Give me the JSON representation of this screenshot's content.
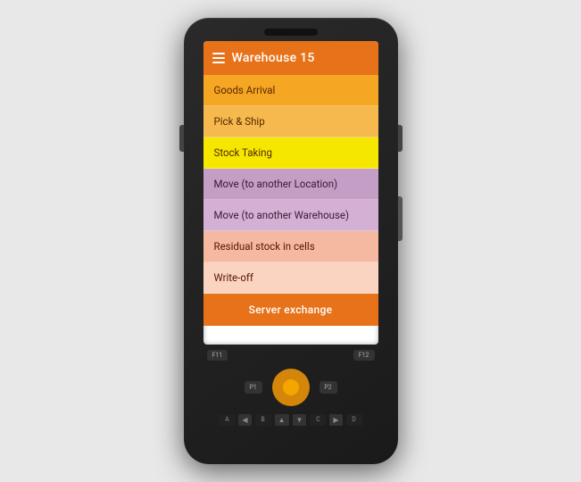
{
  "device": {
    "screen": {
      "header": {
        "title": "Warehouse 15",
        "hamburger_icon": "menu-icon"
      },
      "menu_items": [
        {
          "id": "goods-arrival",
          "label": "Goods Arrival",
          "color_class": "item-goods-arrival"
        },
        {
          "id": "pick-ship",
          "label": "Pick & Ship",
          "color_class": "item-pick-ship"
        },
        {
          "id": "stock-taking",
          "label": "Stock Taking",
          "color_class": "item-stock-taking"
        },
        {
          "id": "move-location",
          "label": "Move (to another Location)",
          "color_class": "item-move-location"
        },
        {
          "id": "move-warehouse",
          "label": "Move (to another Warehouse)",
          "color_class": "item-move-warehouse"
        },
        {
          "id": "residual",
          "label": "Residual stock in cells",
          "color_class": "item-residual"
        },
        {
          "id": "writeoff",
          "label": "Write-off",
          "color_class": "item-writeoff"
        }
      ],
      "server_exchange_label": "Server exchange"
    },
    "keypad": {
      "f11": "F11",
      "f12": "F12",
      "p1": "P1",
      "p2": "P2",
      "alpha_keys": [
        "A",
        "B",
        "C",
        "D"
      ],
      "arrow_up": "▲",
      "arrow_down": "▼",
      "arrow_left": "◀",
      "arrow_right": "▶"
    }
  }
}
